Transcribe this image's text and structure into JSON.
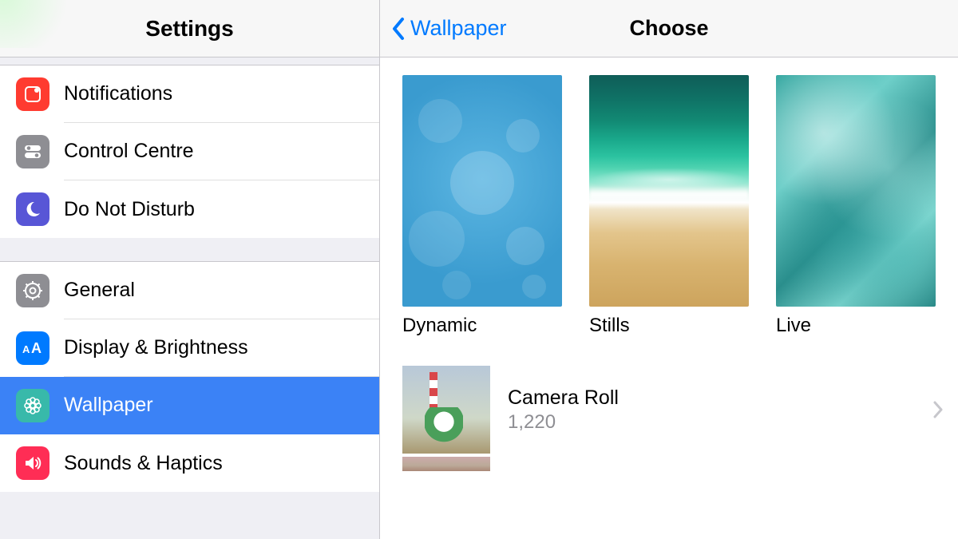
{
  "sidebar": {
    "title": "Settings",
    "groups": [
      [
        {
          "label": "Notifications",
          "icon": "notifications-icon",
          "bg": "bg-red"
        },
        {
          "label": "Control Centre",
          "icon": "switches-icon",
          "bg": "bg-grey"
        },
        {
          "label": "Do Not Disturb",
          "icon": "moon-icon",
          "bg": "bg-purple"
        }
      ],
      [
        {
          "label": "General",
          "icon": "gear-icon",
          "bg": "bg-grey"
        },
        {
          "label": "Display & Brightness",
          "icon": "text-size-icon",
          "bg": "bg-blue"
        },
        {
          "label": "Wallpaper",
          "icon": "flower-icon",
          "bg": "bg-teal",
          "selected": true
        },
        {
          "label": "Sounds & Haptics",
          "icon": "speaker-icon",
          "bg": "bg-pink"
        }
      ]
    ]
  },
  "detail": {
    "back_label": "Wallpaper",
    "title": "Choose",
    "categories": [
      {
        "label": "Dynamic",
        "thumb": "dynamic"
      },
      {
        "label": "Stills",
        "thumb": "stills"
      },
      {
        "label": "Live",
        "thumb": "live"
      }
    ],
    "album": {
      "name": "Camera Roll",
      "count": "1,220"
    }
  }
}
